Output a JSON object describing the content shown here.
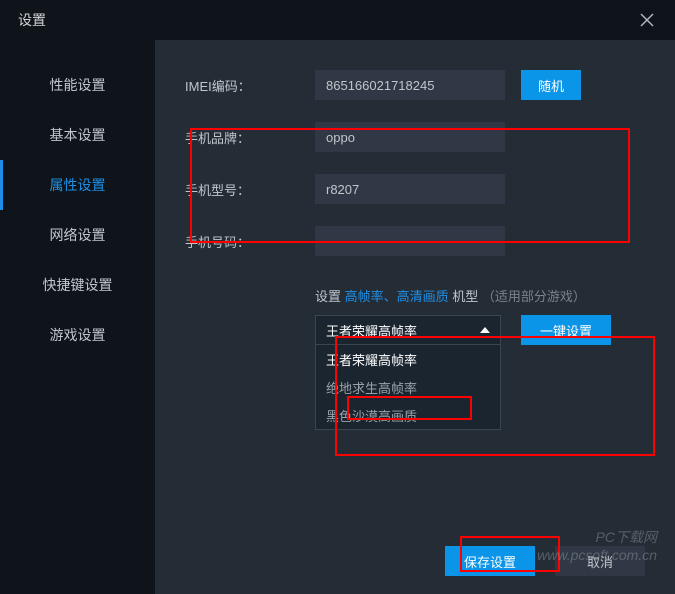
{
  "window": {
    "title": "设置"
  },
  "sidebar": {
    "items": [
      {
        "label": "性能设置"
      },
      {
        "label": "基本设置"
      },
      {
        "label": "属性设置"
      },
      {
        "label": "网络设置"
      },
      {
        "label": "快捷键设置"
      },
      {
        "label": "游戏设置"
      }
    ],
    "activeIndex": 2
  },
  "fields": {
    "imei": {
      "label": "IMEI编码：",
      "value": "865166021718245",
      "random_btn": "随机"
    },
    "brand": {
      "label": "手机品牌：",
      "value": "oppo"
    },
    "model": {
      "label": "手机型号：",
      "value": "r8207"
    },
    "phone": {
      "label": "手机号码：",
      "value": ""
    }
  },
  "config_line": {
    "prefix": "设置",
    "link1": "高帧率、高清画质",
    "suffix": "机型",
    "hint": "（适用部分游戏）"
  },
  "dropdown": {
    "selected": "王者荣耀高帧率",
    "options": [
      "王者荣耀高帧率",
      "绝地求生高帧率",
      "黑色沙漠高画质"
    ]
  },
  "buttons": {
    "one_key": "一键设置",
    "save": "保存设置",
    "cancel": "取消"
  },
  "watermark": {
    "line1": "PC下载网",
    "line2": "www.pcsoft.com.cn"
  }
}
